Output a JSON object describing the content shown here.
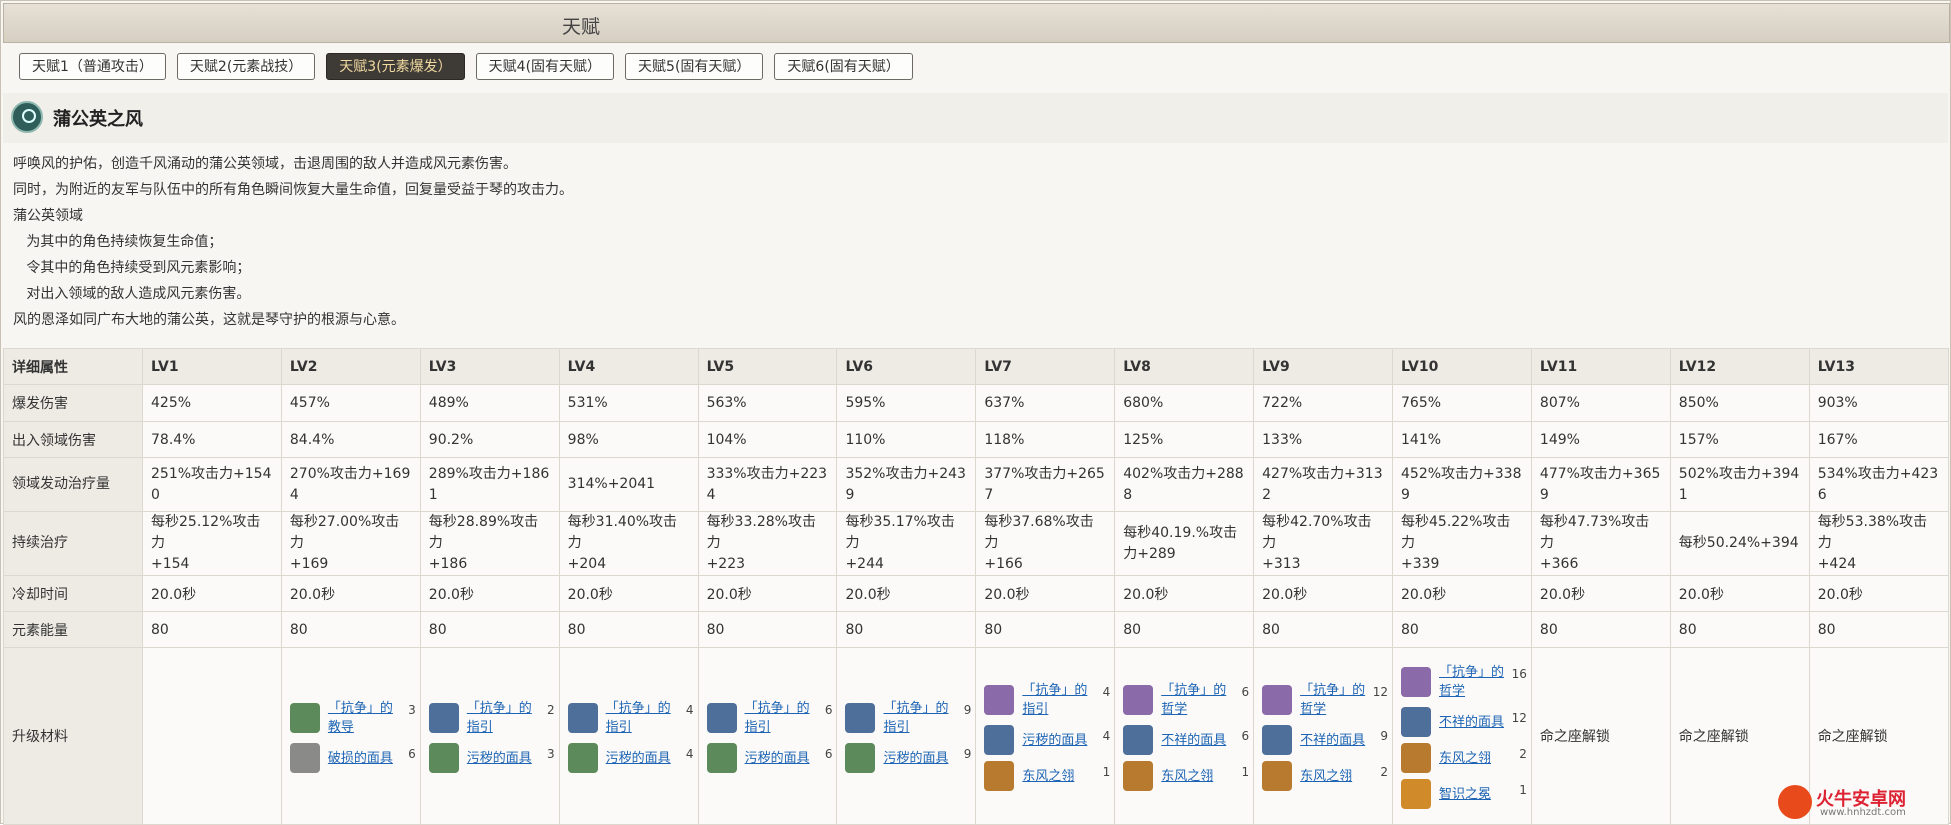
{
  "title": "天赋",
  "tabs": [
    "天赋1（普通攻击）",
    "天赋2(元素战技）",
    "天赋3(元素爆发）",
    "天赋4(固有天赋）",
    "天赋5(固有天赋）",
    "天赋6(固有天赋）"
  ],
  "active_tab": 2,
  "skill": {
    "name": "蒲公英之风",
    "desc": [
      "呼唤风的护佑，创造千风涌动的蒲公英领域，击退周围的敌人并造成风元素伤害。",
      "同时，为附近的友军与队伍中的所有角色瞬间恢复大量生命值，回复量受益于琴的攻击力。",
      "蒲公英领域",
      "   为其中的角色持续恢复生命值；",
      "   令其中的角色持续受到风元素影响；",
      "   对出入领域的敌人造成风元素伤害。",
      "风的恩泽如同广布大地的蒲公英，这就是琴守护的根源与心意。"
    ]
  },
  "table": {
    "header": [
      "详细属性",
      "LV1",
      "LV2",
      "LV3",
      "LV4",
      "LV5",
      "LV6",
      "LV7",
      "LV8",
      "LV9",
      "LV10",
      "LV11",
      "LV12",
      "LV13"
    ],
    "rows": [
      {
        "label": "爆发伤害",
        "cells": [
          "425%",
          "457%",
          "489%",
          "531%",
          "563%",
          "595%",
          "637%",
          "680%",
          "722%",
          "765%",
          "807%",
          "850%",
          "903%"
        ]
      },
      {
        "label": "出入领域伤害",
        "cells": [
          "78.4%",
          "84.4%",
          "90.2%",
          "98%",
          "104%",
          "110%",
          "118%",
          "125%",
          "133%",
          "141%",
          "149%",
          "157%",
          "167%"
        ]
      },
      {
        "label": "领域发动治疗量",
        "cells": [
          "251%攻击力+154\n0",
          "270%攻击力+169\n4",
          "289%攻击力+186\n1",
          "314%+2041",
          "333%攻击力+223\n4",
          "352%攻击力+243\n9",
          "377%攻击力+265\n7",
          "402%攻击力+288\n8",
          "427%攻击力+313\n2",
          "452%攻击力+338\n9",
          "477%攻击力+365\n9",
          "502%攻击力+394\n1",
          "534%攻击力+423\n6"
        ]
      },
      {
        "label": "持续治疗",
        "cells": [
          "每秒25.12%攻击力\n+154",
          "每秒27.00%攻击力\n+169",
          "每秒28.89%攻击力\n+186",
          "每秒31.40%攻击力\n+204",
          "每秒33.28%攻击力\n+223",
          "每秒35.17%攻击力\n+244",
          "每秒37.68%攻击力\n+166",
          "每秒40.19.%攻击\n力+289",
          "每秒42.70%攻击力\n+313",
          "每秒45.22%攻击力\n+339",
          "每秒47.73%攻击力\n+366",
          "每秒50.24%+394",
          "每秒53.38%攻击力\n+424"
        ]
      },
      {
        "label": "冷却时间",
        "cells": [
          "20.0秒",
          "20.0秒",
          "20.0秒",
          "20.0秒",
          "20.0秒",
          "20.0秒",
          "20.0秒",
          "20.0秒",
          "20.0秒",
          "20.0秒",
          "20.0秒",
          "20.0秒",
          "20.0秒"
        ]
      },
      {
        "label": "元素能量",
        "cells": [
          "80",
          "80",
          "80",
          "80",
          "80",
          "80",
          "80",
          "80",
          "80",
          "80",
          "80",
          "80",
          "80"
        ]
      }
    ],
    "material_label": "升级材料",
    "materials": [
      [],
      [
        {
          "name": "「抗争」的教导",
          "count": "3",
          "color": "#5c8a5a"
        },
        {
          "name": "破损的面具",
          "count": "6",
          "color": "#8a8a88"
        }
      ],
      [
        {
          "name": "「抗争」的指引",
          "count": "2",
          "color": "#4f6f9b"
        },
        {
          "name": "污秽的面具",
          "count": "3",
          "color": "#5c8a5a"
        }
      ],
      [
        {
          "name": "「抗争」的指引",
          "count": "4",
          "color": "#4f6f9b"
        },
        {
          "name": "污秽的面具",
          "count": "4",
          "color": "#5c8a5a"
        }
      ],
      [
        {
          "name": "「抗争」的指引",
          "count": "6",
          "color": "#4f6f9b"
        },
        {
          "name": "污秽的面具",
          "count": "6",
          "color": "#5c8a5a"
        }
      ],
      [
        {
          "name": "「抗争」的指引",
          "count": "9",
          "color": "#4f6f9b"
        },
        {
          "name": "污秽的面具",
          "count": "9",
          "color": "#5c8a5a"
        }
      ],
      [
        {
          "name": "「抗争」的指引",
          "count": "4",
          "color": "#8a6aa8"
        },
        {
          "name": "污秽的面具",
          "count": "4",
          "color": "#4f6f9b"
        },
        {
          "name": "东风之翎",
          "count": "1",
          "color": "#b87a2e"
        }
      ],
      [
        {
          "name": "「抗争」的哲学",
          "count": "6",
          "color": "#8a6aa8"
        },
        {
          "name": "不祥的面具",
          "count": "6",
          "color": "#4f6f9b"
        },
        {
          "name": "东风之翎",
          "count": "1",
          "color": "#b87a2e"
        }
      ],
      [
        {
          "name": "「抗争」的哲学",
          "count": "12",
          "color": "#8a6aa8"
        },
        {
          "name": "不祥的面具",
          "count": "9",
          "color": "#4f6f9b"
        },
        {
          "name": "东风之翎",
          "count": "2",
          "color": "#b87a2e"
        }
      ],
      [
        {
          "name": "「抗争」的哲学",
          "count": "16",
          "color": "#8a6aa8"
        },
        {
          "name": "不祥的面具",
          "count": "12",
          "color": "#4f6f9b"
        },
        {
          "name": "东风之翎",
          "count": "2",
          "color": "#b87a2e"
        },
        {
          "name": "智识之冕",
          "count": "1",
          "color": "#d08a2a"
        }
      ],
      "命之座解锁",
      "命之座解锁",
      "命之座解锁"
    ]
  },
  "watermark": {
    "name": "火牛安卓网",
    "url": "www.hnhzdt.com"
  }
}
